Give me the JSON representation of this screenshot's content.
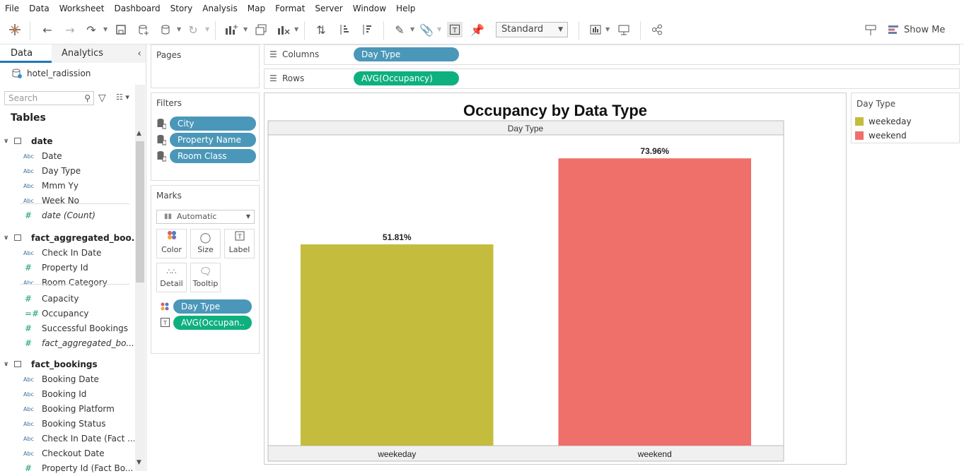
{
  "menu": [
    "File",
    "Data",
    "Worksheet",
    "Dashboard",
    "Story",
    "Analysis",
    "Map",
    "Format",
    "Server",
    "Window",
    "Help"
  ],
  "toolbar": {
    "mark_type_select": "Standard",
    "show_me": "Show Me"
  },
  "data_pane": {
    "tab_data": "Data",
    "tab_analytics": "Analytics",
    "datasource": "hotel_radission",
    "search_placeholder": "Search",
    "tables_label": "Tables",
    "tables": [
      {
        "name": "date",
        "fields": [
          {
            "type": "Abc",
            "name": "Date"
          },
          {
            "type": "Abc",
            "name": "Day Type"
          },
          {
            "type": "Abc",
            "name": "Mmm Yy"
          },
          {
            "type": "Abc",
            "name": "Week No"
          },
          {
            "type": "#",
            "name": "date (Count)",
            "italic": true
          }
        ]
      },
      {
        "name": "fact_aggregated_boo...",
        "fields": [
          {
            "type": "Abc",
            "name": "Check In Date"
          },
          {
            "type": "#",
            "name": "Property Id"
          },
          {
            "type": "Abc",
            "name": "Room Category"
          },
          {
            "type": "#",
            "name": "Capacity"
          },
          {
            "type": "=#",
            "name": "Occupancy"
          },
          {
            "type": "#",
            "name": "Successful Bookings"
          },
          {
            "type": "#",
            "name": "fact_aggregated_bo...",
            "italic": true
          }
        ]
      },
      {
        "name": "fact_bookings",
        "fields": [
          {
            "type": "Abc",
            "name": "Booking Date"
          },
          {
            "type": "Abc",
            "name": "Booking Id"
          },
          {
            "type": "Abc",
            "name": "Booking Platform"
          },
          {
            "type": "Abc",
            "name": "Booking Status"
          },
          {
            "type": "Abc",
            "name": "Check In Date (Fact ..."
          },
          {
            "type": "Abc",
            "name": "Checkout Date"
          },
          {
            "type": "#",
            "name": "Property Id (Fact Bo..."
          }
        ]
      }
    ]
  },
  "pages_card": {
    "title": "Pages"
  },
  "filters_card": {
    "title": "Filters",
    "items": [
      "City",
      "Property Name",
      "Room Class"
    ]
  },
  "marks_card": {
    "title": "Marks",
    "mark_type": "Automatic",
    "buttons": [
      "Color",
      "Size",
      "Label",
      "Detail",
      "Tooltip"
    ],
    "pills": [
      "Day Type",
      "AVG(Occupan.."
    ]
  },
  "shelves": {
    "columns_label": "Columns",
    "columns_pill": "Day Type",
    "rows_label": "Rows",
    "rows_pill": "AVG(Occupancy)"
  },
  "legend": {
    "title": "Day Type",
    "items": [
      {
        "name": "weekeday",
        "color": "#c4bc3c"
      },
      {
        "name": "weekend",
        "color": "#ef6f6a"
      }
    ]
  },
  "chart_data": {
    "type": "bar",
    "title": "Occupancy by Data Type",
    "header": "Day Type",
    "categories": [
      "weekeday",
      "weekend"
    ],
    "values": [
      51.81,
      73.96
    ],
    "labels": [
      "51.81%",
      "73.96%"
    ],
    "colors": [
      "#c4bc3c",
      "#ef6f6a"
    ],
    "ylim": [
      0,
      80
    ]
  }
}
